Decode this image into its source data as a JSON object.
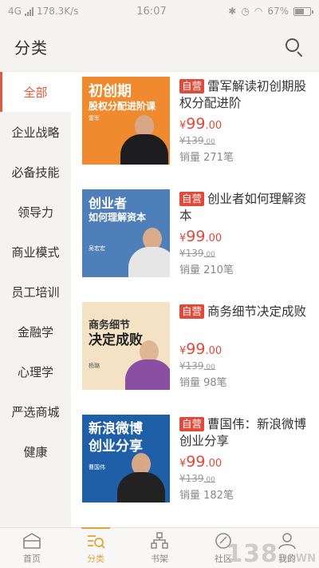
{
  "status_bar": {
    "network": "4G",
    "speed": "178.3K/s",
    "time": "16:07",
    "battery": "67%",
    "battery_level": 0.67
  },
  "header": {
    "title": "分类",
    "search_icon": "search-icon"
  },
  "sidebar": {
    "items": [
      {
        "label": "全部",
        "active": true
      },
      {
        "label": "企业战略"
      },
      {
        "label": "必备技能"
      },
      {
        "label": "领导力"
      },
      {
        "label": "商业模式"
      },
      {
        "label": "员工培训"
      },
      {
        "label": "金融学"
      },
      {
        "label": "心理学"
      },
      {
        "label": "严选商城"
      },
      {
        "label": "健康"
      }
    ]
  },
  "products": [
    {
      "badge": "自营",
      "title": "雷军解读初创期股权分配进阶",
      "price_symbol": "¥",
      "price_int": "99",
      "price_dec": ".00",
      "orig_price_int": "¥139",
      "orig_price_dec": ".00",
      "sold": "销量 271笔",
      "cover": {
        "line1": "初创期",
        "line2": "股权分配进阶课",
        "caption": "雷军"
      }
    },
    {
      "badge": "自营",
      "title": "创业者如何理解资本",
      "price_symbol": "¥",
      "price_int": "99",
      "price_dec": ".00",
      "orig_price_int": "¥139",
      "orig_price_dec": ".00",
      "sold": "销量 210笔",
      "cover": {
        "line1": "创业者",
        "line2": "如何理解资本",
        "caption": "吴宏宏"
      }
    },
    {
      "badge": "自营",
      "title": "商务细节决定成败",
      "price_symbol": "¥",
      "price_int": "99",
      "price_dec": ".00",
      "orig_price_int": "¥139",
      "orig_price_dec": ".00",
      "sold": "销量 98笔",
      "cover": {
        "line1": "商务细节",
        "line2": "决定成败",
        "caption": "杨璐"
      }
    },
    {
      "badge": "自营",
      "title": "曹国伟：新浪微博创业分享",
      "price_symbol": "¥",
      "price_int": "99",
      "price_dec": ".00",
      "orig_price_int": "¥139",
      "orig_price_dec": ".00",
      "sold": "销量 182笔",
      "cover": {
        "line1": "新浪微博",
        "line2": "创业分享",
        "caption": "曹国伟"
      }
    }
  ],
  "tabbar": {
    "items": [
      {
        "label": "首页",
        "icon": "home-icon"
      },
      {
        "label": "分类",
        "icon": "category-icon",
        "active": true
      },
      {
        "label": "书架",
        "icon": "bookshelf-icon"
      },
      {
        "label": "社区",
        "icon": "community-icon"
      },
      {
        "label": "我的",
        "icon": "profile-icon"
      }
    ]
  },
  "watermark": {
    "text": "138",
    "suffix": "DOWN"
  },
  "colors": {
    "accent": "#e25a3c",
    "price": "#e04a3a",
    "tab_active": "#e2a23c"
  }
}
